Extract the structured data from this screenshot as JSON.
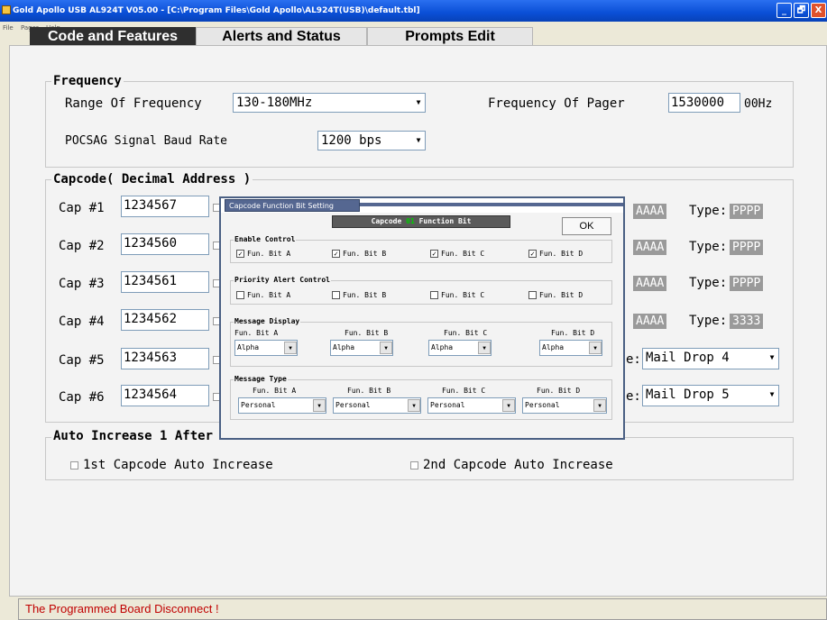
{
  "window": {
    "title": "Gold Apollo USB AL924T V05.00 - [C:\\Program Files\\Gold Apollo\\AL924T(USB)\\default.tbl]",
    "minimize": "_",
    "maximize": "🗗",
    "close": "X"
  },
  "menu": [
    "File",
    "Pager",
    "Help"
  ],
  "tabs": [
    "Code and Features",
    "Alerts and Status",
    "Prompts Edit"
  ],
  "frequency": {
    "legend": "Frequency",
    "range_label": "Range Of Frequency",
    "range_value": "130-180MHz",
    "pager_label": "Frequency Of Pager",
    "pager_value": "1530000",
    "pager_unit": "00Hz",
    "baud_label": "POCSAG Signal Baud Rate",
    "baud_value": "1200 bps"
  },
  "capcode": {
    "legend": "Capcode( Decimal Address )",
    "rows": [
      {
        "label": "Cap #1",
        "value": "1234567",
        "code": "AAAA",
        "type_label": "Type:",
        "type_value": "PPPP"
      },
      {
        "label": "Cap #2",
        "value": "1234560",
        "code": "AAAA",
        "type_label": "Type:",
        "type_value": "PPPP"
      },
      {
        "label": "Cap #3",
        "value": "1234561",
        "code": "AAAA",
        "type_label": "Type:",
        "type_value": "PPPP"
      },
      {
        "label": "Cap #4",
        "value": "1234562",
        "code": "AAAA",
        "type_label": "Type:",
        "type_value": "3333"
      },
      {
        "label": "Cap #5",
        "value": "1234563",
        "right_prefix": "e:",
        "right_value": "Mail Drop 4"
      },
      {
        "label": "Cap #6",
        "value": "1234564",
        "right_prefix": "e:",
        "right_value": "Mail Drop 5"
      }
    ]
  },
  "auto_increase": {
    "legend": "Auto Increase 1 After Write",
    "option1": "1st Capcode Auto Increase",
    "option2": "2nd Capcode Auto Increase"
  },
  "status": {
    "message": "The Programmed Board Disconnect !"
  },
  "dialog": {
    "title": "Capcode Function Bit Setting",
    "header_prefix": "Capcode",
    "header_number": "01",
    "header_suffix": "Function Bit",
    "ok_label": "OK",
    "enable_control": {
      "legend": "Enable Control",
      "items": [
        {
          "label": "Fun. Bit A",
          "checked": "✓"
        },
        {
          "label": "Fun. Bit B",
          "checked": "✓"
        },
        {
          "label": "Fun. Bit C",
          "checked": "✓"
        },
        {
          "label": "Fun. Bit D",
          "checked": "✓"
        }
      ]
    },
    "priority_alert": {
      "legend": "Priority Alert Control",
      "items": [
        {
          "label": "Fun. Bit A"
        },
        {
          "label": "Fun. Bit B"
        },
        {
          "label": "Fun. Bit C"
        },
        {
          "label": "Fun. Bit D"
        }
      ]
    },
    "message_display": {
      "legend": "Message Display",
      "items": [
        {
          "label": "Fun. Bit A",
          "value": "Alpha"
        },
        {
          "label": "Fun. Bit B",
          "value": "Alpha"
        },
        {
          "label": "Fun. Bit C",
          "value": "Alpha"
        },
        {
          "label": "Fun. Bit D",
          "value": "Alpha"
        }
      ]
    },
    "message_type": {
      "legend": "Message Type",
      "items": [
        {
          "label": "Fun. Bit A",
          "value": "Personal"
        },
        {
          "label": "Fun. Bit B",
          "value": "Personal"
        },
        {
          "label": "Fun. Bit C",
          "value": "Personal"
        },
        {
          "label": "Fun. Bit D",
          "value": "Personal"
        }
      ]
    }
  },
  "colors": {
    "title_bar": "#0a4fd6",
    "active_tab": "#2f2f2f",
    "chip": "#9a9a9a",
    "status_text": "#c00000",
    "dialog_accent": "#556791",
    "capcode_number": "#00cc00"
  },
  "icons": {
    "app": "app-icon",
    "dropdown": "chevron-down-icon",
    "checkbox": "checkbox-icon"
  }
}
